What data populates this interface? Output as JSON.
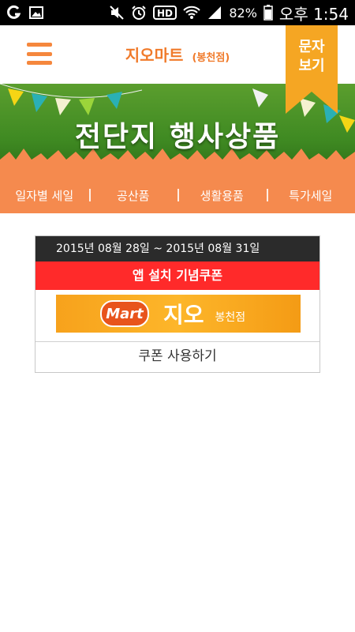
{
  "status_bar": {
    "battery_percent": "82%",
    "time": "오후 1:54",
    "hd_label": "HD",
    "icons": [
      "carrier-g-icon",
      "gallery-icon",
      "mute-icon",
      "alarm-icon",
      "hd-icon",
      "wifi-icon",
      "signal-icon",
      "battery-icon"
    ]
  },
  "header": {
    "title": "지오마트",
    "subtitle": "(봉천점)",
    "sms_button_label": "문자\n보기",
    "accent_color": "#f07a2a"
  },
  "banner": {
    "title": "전단지 행사상품"
  },
  "nav": {
    "items": [
      {
        "label": "일자별 세일"
      },
      {
        "label": "공산품"
      },
      {
        "label": "생활용품"
      },
      {
        "label": "특가세일"
      }
    ],
    "background_color": "#f58a4e"
  },
  "coupon": {
    "date_range": "2015년 08월 28일 ~ 2015년 08월 31일",
    "title": "앱 설치 기념쿠폰",
    "logo_badge": "Mart",
    "logo_name": "지오",
    "logo_branch": "봉천점",
    "use_button": "쿠폰 사용하기",
    "title_color": "#ff2a2a"
  }
}
